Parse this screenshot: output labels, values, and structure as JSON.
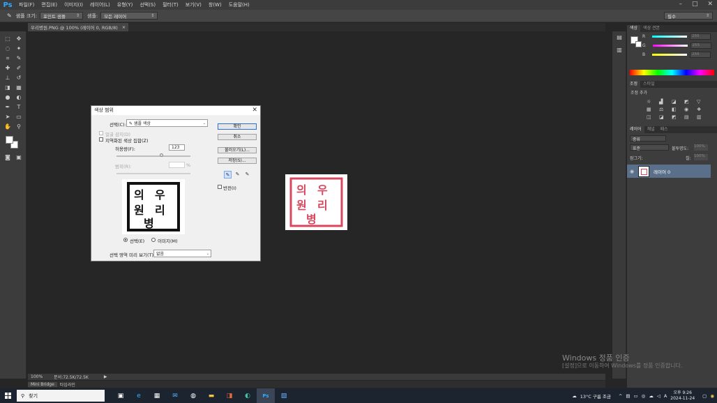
{
  "app": {
    "logo": "Ps",
    "menus": [
      "파일(F)",
      "편집(E)",
      "이미지(I)",
      "레이어(L)",
      "유형(Y)",
      "선택(S)",
      "필터(T)",
      "보기(V)",
      "창(W)",
      "도움말(H)"
    ],
    "window_controls": [
      "–",
      "□",
      "✕"
    ]
  },
  "options_bar": {
    "sample_size_label": "샘플 크기:",
    "sample_size_value": "포인트 샘플",
    "sample_label": "샘플:",
    "sample_value": "모든 레이어",
    "workspace_value": "필수"
  },
  "document": {
    "tab_title": "우리병원.PNG @ 100% (레이어 0, RGB/8)",
    "tab_close": "×"
  },
  "status": {
    "zoom": "100%",
    "doc_size": "문서:72.5K/72.5K",
    "arrow": "▶"
  },
  "bottom_tabs": [
    "Mini Bridge",
    "타임라인"
  ],
  "dialog": {
    "title": "색상 범위",
    "close": "✕",
    "select_label": "선택(C):",
    "select_value": "샘플 색상",
    "detect_faces_label": "얼굴 감지(D)",
    "localized_label": "지역화된 색상 집합(Z)",
    "fuzziness_label": "허용량(F):",
    "fuzziness_value": "123",
    "range_label": "범위(R):",
    "range_unit": "%",
    "radio_selection": "선택(E)",
    "radio_image": "이미지(M)",
    "preview_label": "선택 영역 미리 보기(T):",
    "preview_value": "없음",
    "ok_label": "확인",
    "cancel_label": "취소",
    "load_label": "불러오기(L)...",
    "save_label": "저장(S)...",
    "invert_label": "반전(I)"
  },
  "stamp": {
    "text": "의우원리병",
    "color_canvas": "#d8475e",
    "color_preview": "#111111"
  },
  "right_panel": {
    "color_tabs": [
      "색상",
      "색상 견본"
    ],
    "color_rows": [
      {
        "label": "R",
        "value": "255"
      },
      {
        "label": "G",
        "value": "255"
      },
      {
        "label": "B",
        "value": "255"
      }
    ],
    "adjust_tabs": [
      "조정",
      "스타일"
    ],
    "adjust_title": "조정 추가",
    "layer_tabs": [
      "레이어",
      "채널",
      "패스"
    ],
    "filter_label": "종류",
    "blend_mode": "표준",
    "opacity_label": "불투명도:",
    "opacity_value": "100%",
    "lock_label": "잠그기:",
    "fill_label": "칠:",
    "fill_value": "100%",
    "layer_name": "레이어 0"
  },
  "watermark": {
    "line1": "Windows 정품 인증",
    "line2": "[설정]으로 이동하여 Windows를 정품 인증합니다."
  },
  "taskbar": {
    "search_placeholder": "찾기",
    "weather": "13°C 구름 조금",
    "time": "오후 9:26",
    "date": "2024-11-24",
    "ime": "A"
  }
}
